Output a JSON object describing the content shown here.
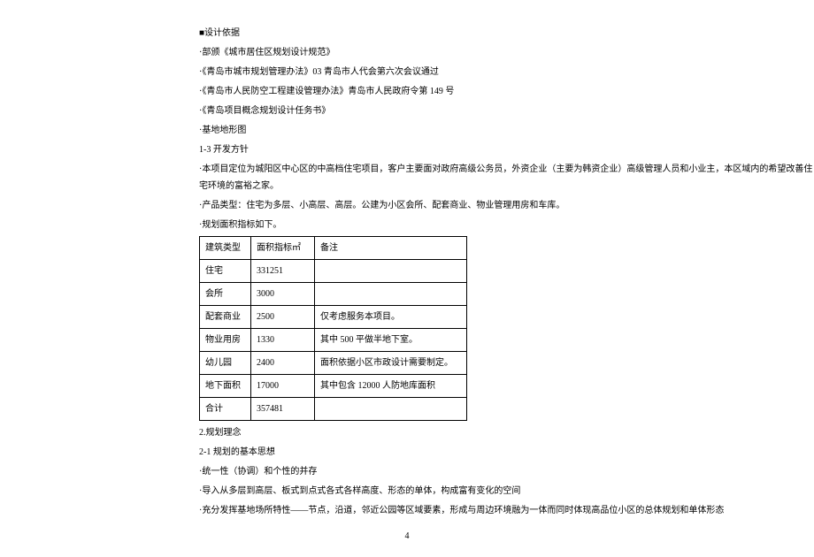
{
  "lines": {
    "l1": "■设计依据",
    "l2": "·部颁《城市居住区规划设计规范》",
    "l3": "·《青岛市城市规划管理办法》03 青岛市人代会第六次会议通过",
    "l4": "·《青岛市人民防空工程建设管理办法》青岛市人民政府令第 149 号",
    "l5": "·《青岛项目概念规划设计任务书》",
    "l6": "·基地地形图",
    "l7": "1-3 开发方针",
    "l8": "·本项目定位为城阳区中心区的中高档住宅项目，客户主要面对政府高级公务员，外资企业（主要为韩资企业）高级管理人员和小业主，本区域内的希望改善住宅环境的富裕之家。",
    "l9": "·产品类型：住宅为多层、小高层、高层。公建为小区会所、配套商业、物业管理用房和车库。",
    "l10": "·规划面积指标如下。",
    "l11": "2.规划理念",
    "l12": "2-1 规划的基本思想",
    "l13": "·统一性（协调）和个性的并存",
    "l14": "·导入从多层到高层、板式到点式各式各样高度、形态的单体，构成富有变化的空间",
    "l15": "·充分发挥基地场所特性——节点，沿道，邻近公园等区域要素，形成与周边环境融为一体而同时体现高品位小区的总体规划和单体形态"
  },
  "table": {
    "header": {
      "type": "建筑类型",
      "area": "面积指标㎡",
      "note": "备注"
    },
    "rows": [
      {
        "type": "住宅",
        "area": "331251",
        "note": ""
      },
      {
        "type": "会所",
        "area": "3000",
        "note": ""
      },
      {
        "type": "配套商业",
        "area": "2500",
        "note": "仅考虑服务本项目。"
      },
      {
        "type": "物业用房",
        "area": "1330",
        "note": "其中 500 平做半地下室。"
      },
      {
        "type": "幼儿园",
        "area": "2400",
        "note": "面积依据小区市政设计需要制定。"
      },
      {
        "type": "地下面积",
        "area": "17000",
        "note": "其中包含 12000 人防地库面积"
      },
      {
        "type": "合计",
        "area": "357481",
        "note": ""
      }
    ]
  },
  "page_number": "4"
}
